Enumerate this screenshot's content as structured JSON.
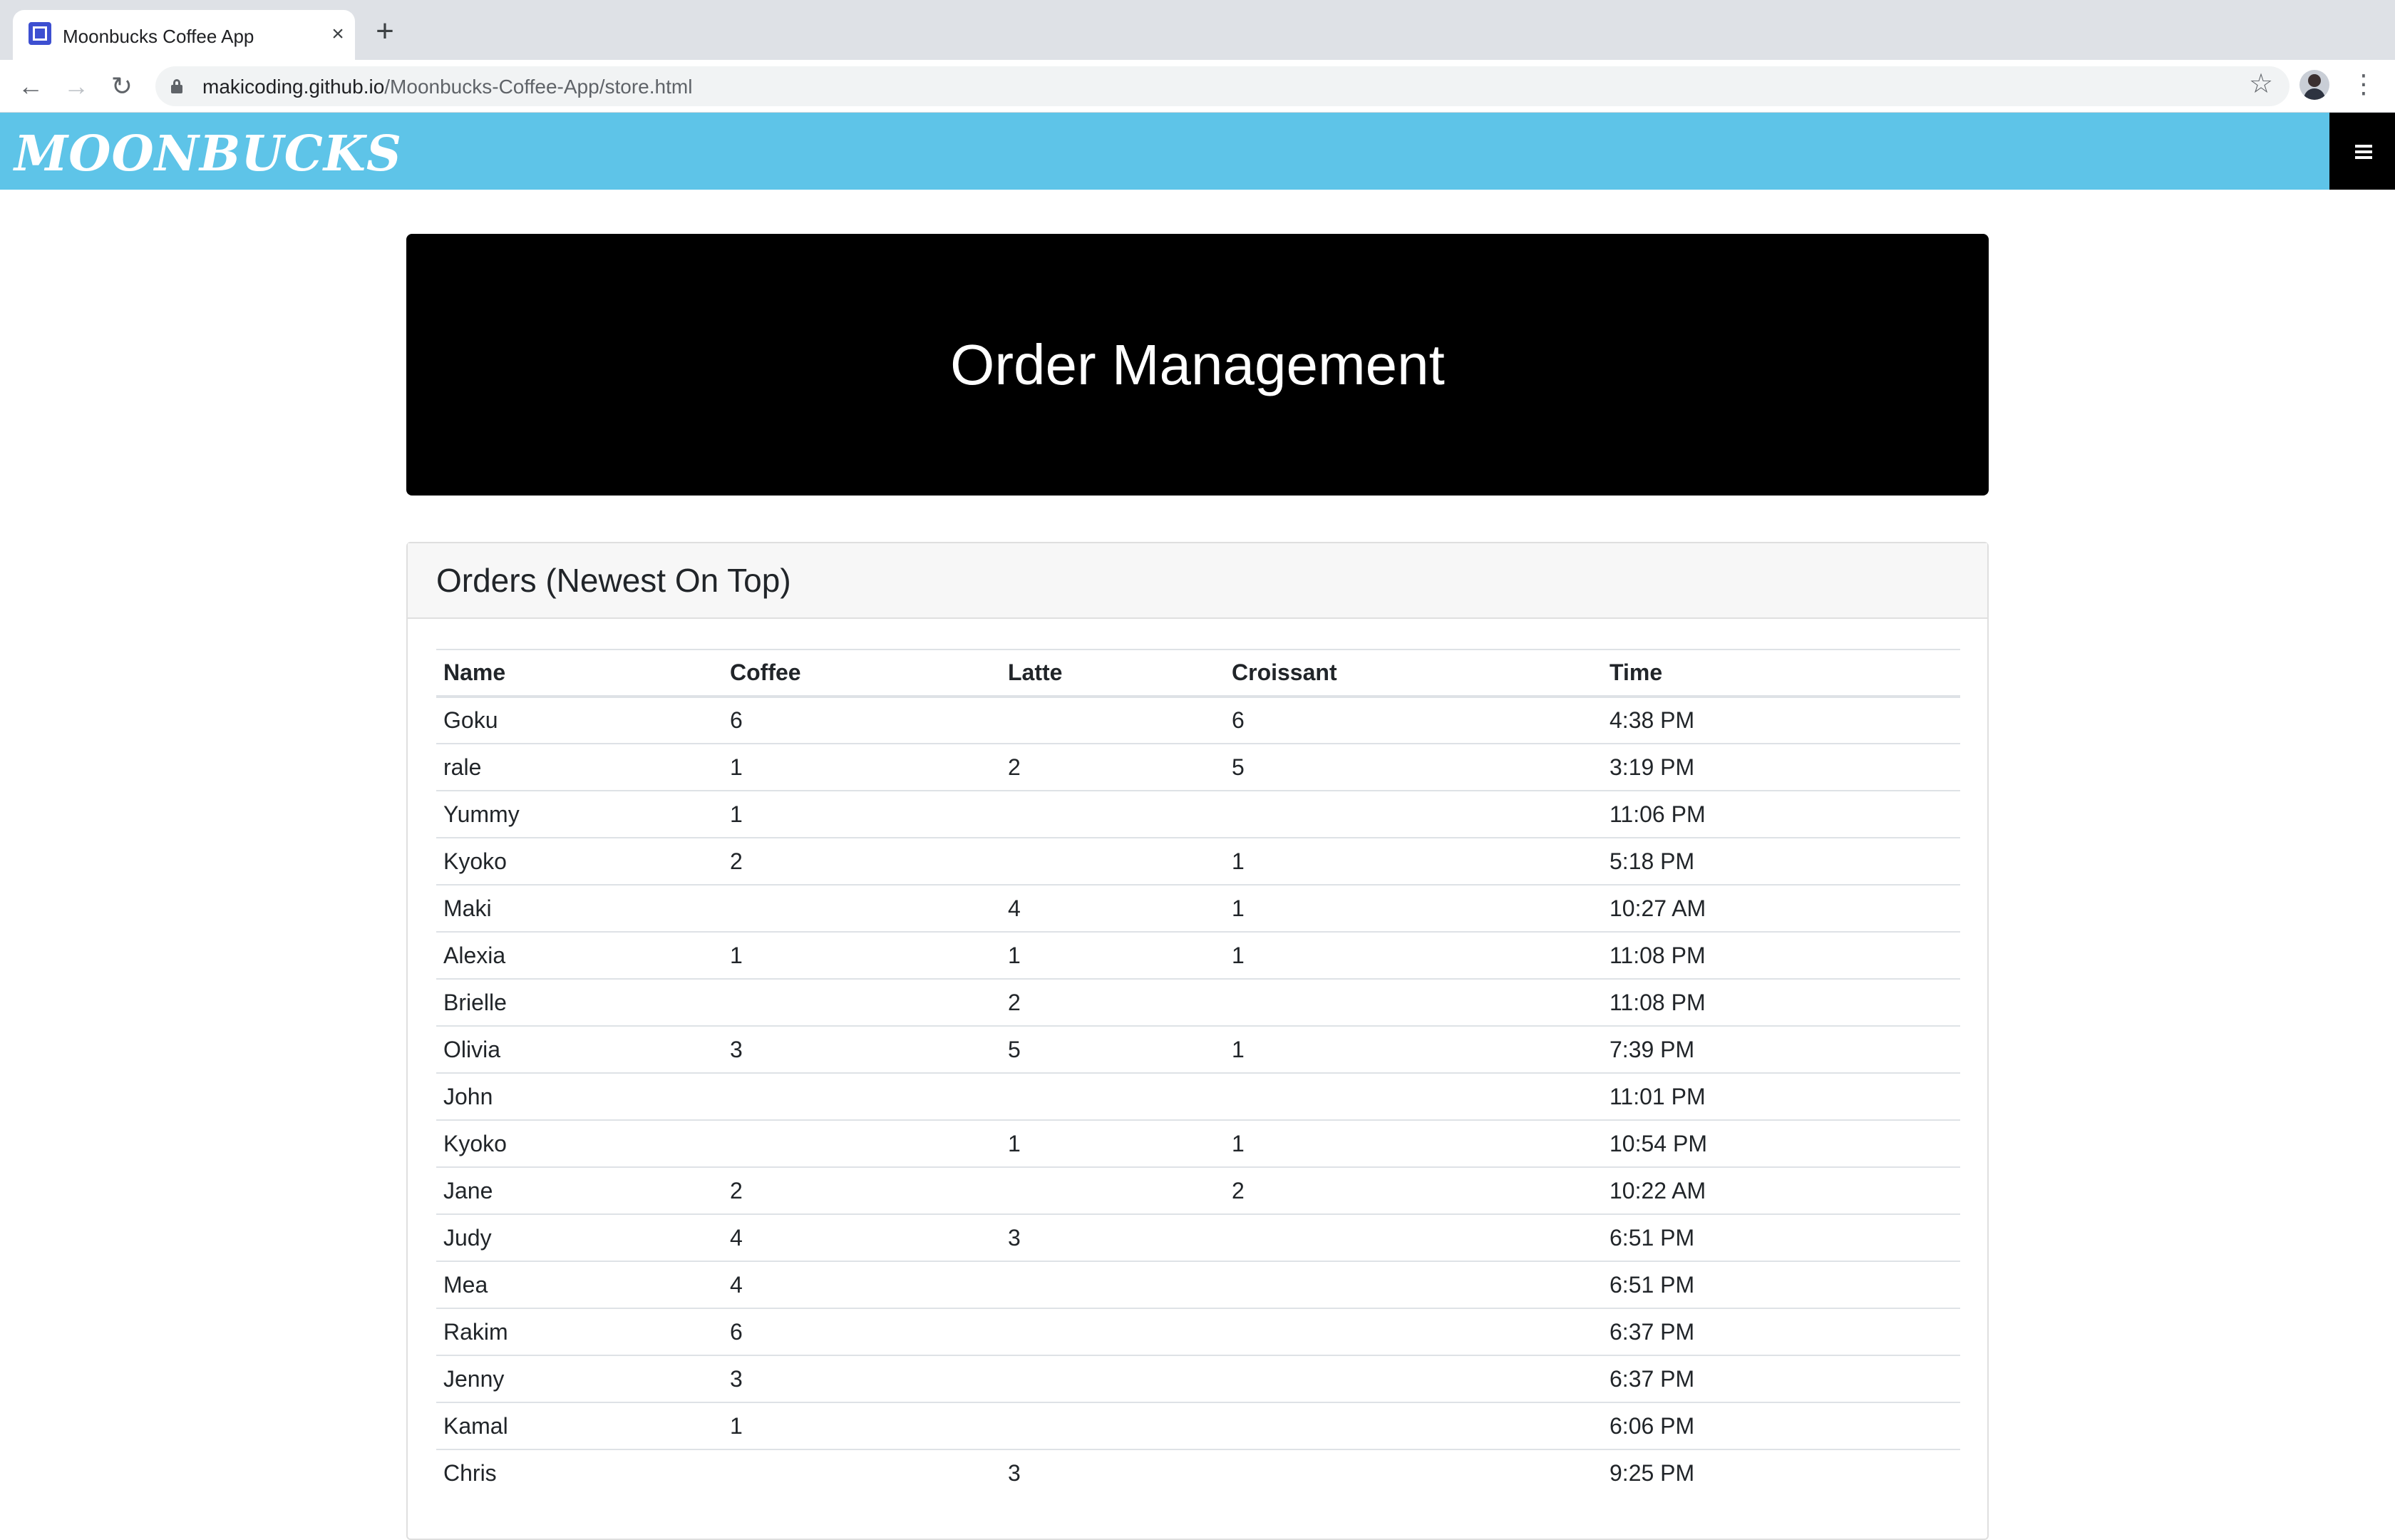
{
  "browser": {
    "tab_title": "Moonbucks Coffee App",
    "tab_close": "×",
    "new_tab": "+",
    "url_host": "makicoding.github.io",
    "url_path": "/Moonbucks-Coffee-App/store.html",
    "icons": [
      "favicon-icon",
      "back-icon",
      "forward-icon",
      "reload-icon",
      "lock-icon",
      "star-icon",
      "avatar",
      "menu-icon"
    ]
  },
  "navbar": {
    "brand": "MOONBUCKS",
    "background": "#5ec4e8"
  },
  "jumbotron": {
    "title": "Order Management"
  },
  "orders": {
    "heading": "Orders (Newest On Top)",
    "columns": [
      "Name",
      "Coffee",
      "Latte",
      "Croissant",
      "Time"
    ],
    "rows": [
      {
        "name": "Goku",
        "coffee": "6",
        "latte": "",
        "croissant": "6",
        "time": "4:38 PM"
      },
      {
        "name": "rale",
        "coffee": "1",
        "latte": "2",
        "croissant": "5",
        "time": "3:19 PM"
      },
      {
        "name": "Yummy",
        "coffee": "1",
        "latte": "",
        "croissant": "",
        "time": "11:06 PM"
      },
      {
        "name": "Kyoko",
        "coffee": "2",
        "latte": "",
        "croissant": "1",
        "time": "5:18 PM"
      },
      {
        "name": "Maki",
        "coffee": "",
        "latte": "4",
        "croissant": "1",
        "time": "10:27 AM"
      },
      {
        "name": "Alexia",
        "coffee": "1",
        "latte": "1",
        "croissant": "1",
        "time": "11:08 PM"
      },
      {
        "name": "Brielle",
        "coffee": "",
        "latte": "2",
        "croissant": "",
        "time": "11:08 PM"
      },
      {
        "name": "Olivia",
        "coffee": "3",
        "latte": "5",
        "croissant": "1",
        "time": "7:39 PM"
      },
      {
        "name": "John",
        "coffee": "",
        "latte": "",
        "croissant": "",
        "time": "11:01 PM"
      },
      {
        "name": "Kyoko",
        "coffee": "",
        "latte": "1",
        "croissant": "1",
        "time": "10:54 PM"
      },
      {
        "name": "Jane",
        "coffee": "2",
        "latte": "",
        "croissant": "2",
        "time": "10:22 AM"
      },
      {
        "name": "Judy",
        "coffee": "4",
        "latte": "3",
        "croissant": "",
        "time": "6:51 PM"
      },
      {
        "name": "Mea",
        "coffee": "4",
        "latte": "",
        "croissant": "",
        "time": "6:51 PM"
      },
      {
        "name": "Rakim",
        "coffee": "6",
        "latte": "",
        "croissant": "",
        "time": "6:37 PM"
      },
      {
        "name": "Jenny",
        "coffee": "3",
        "latte": "",
        "croissant": "",
        "time": "6:37 PM"
      },
      {
        "name": "Kamal",
        "coffee": "1",
        "latte": "",
        "croissant": "",
        "time": "6:06 PM"
      },
      {
        "name": "Chris",
        "coffee": "",
        "latte": "3",
        "croissant": "",
        "time": "9:25 PM"
      }
    ]
  }
}
